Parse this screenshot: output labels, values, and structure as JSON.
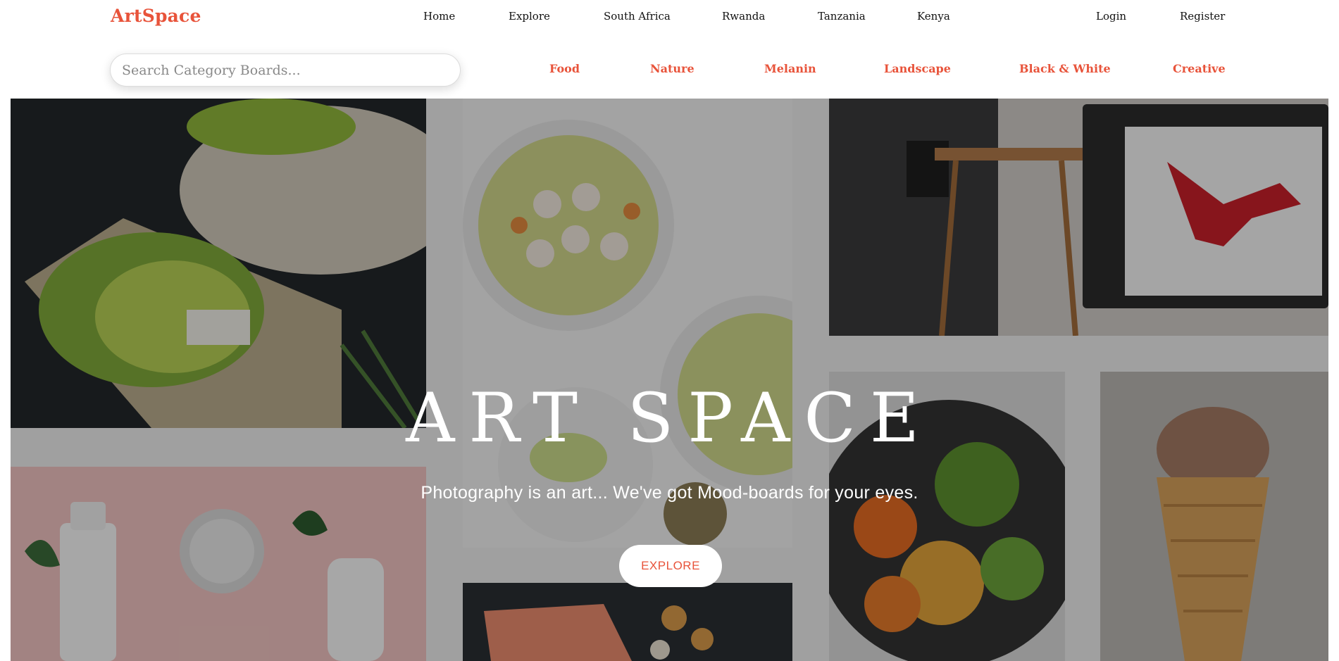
{
  "brand": "ArtSpace",
  "nav": {
    "home": "Home",
    "explore": "Explore",
    "south_africa": "South Africa",
    "rwanda": "Rwanda",
    "tanzania": "Tanzania",
    "kenya": "Kenya",
    "login": "Login",
    "register": "Register"
  },
  "search": {
    "placeholder": "Search Category Boards...",
    "value": ""
  },
  "categories": {
    "food": "Food",
    "nature": "Nature",
    "melanin": "Melanin",
    "landscape": "Landscape",
    "black_white": "Black & White",
    "creative": "Creative"
  },
  "hero": {
    "title": "ART SPACE",
    "subtitle": "Photography is an art... We've got Mood-boards for your eyes.",
    "button": "EXPLORE"
  },
  "colors": {
    "accent": "#e8533a",
    "text": "#111111",
    "hero_background": "#ececec"
  }
}
